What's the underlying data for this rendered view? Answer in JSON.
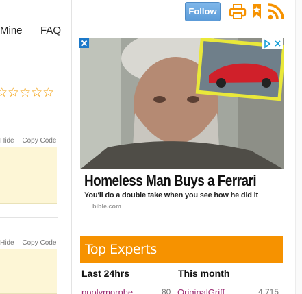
{
  "left_nav": {
    "mine": "Mine",
    "faq": "FAQ"
  },
  "rating_stars": "☆☆☆☆☆",
  "code_tools": [
    {
      "hide": "Hide",
      "copy": "Copy Code"
    },
    {
      "hide": "Hide",
      "copy": "Copy Code"
    }
  ],
  "toolbar": {
    "follow_label": "Follow"
  },
  "icons": {
    "print": "print-icon",
    "bookmark": "bookmark-icon",
    "rss": "rss-icon",
    "ad_close": "close-icon",
    "ad_choices": "adchoices-icon"
  },
  "ad": {
    "headline": "Homeless Man Buys a Ferrari",
    "subline": "You'll do a double take when you see how he did it",
    "source": "bible.com"
  },
  "top_experts": {
    "title": "Top Experts",
    "last_24_label": "Last 24hrs",
    "this_month_label": "This month",
    "rows": [
      {
        "name_24": "ppolymorphe",
        "score_24": "80",
        "name_month": "OriginalGriff",
        "score_month": "4,715"
      }
    ]
  },
  "colors": {
    "accent": "#f69200",
    "follow": "#5b9bd8",
    "expert_link": "#9b2f74",
    "star": "#f29b00"
  }
}
